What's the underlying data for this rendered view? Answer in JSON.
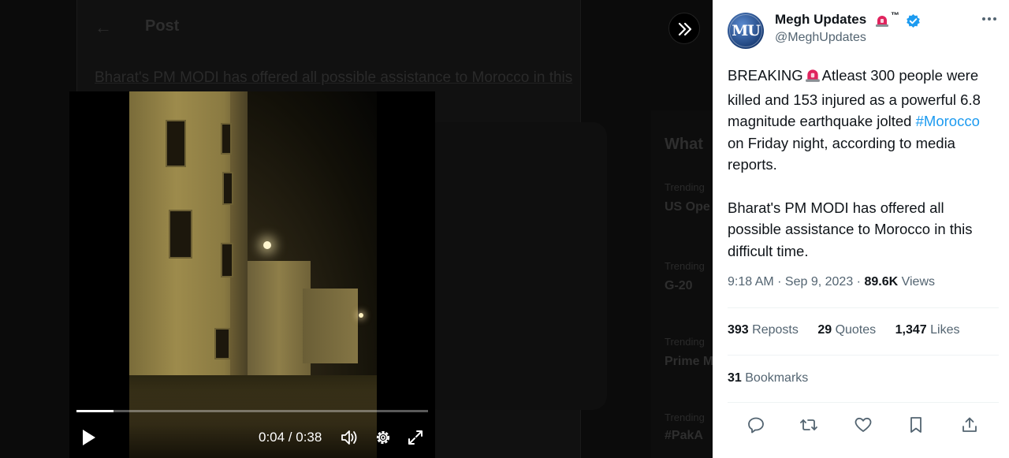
{
  "background": {
    "title": "Post",
    "text": "Bharat's PM MODI has offered all possible assistance to Morocco in this",
    "trends": [
      {
        "label": "What"
      },
      {
        "label": "Trending"
      },
      {
        "label": "US Ope"
      },
      {
        "label": "Trending"
      },
      {
        "label": "G-20"
      },
      {
        "label": "Trending"
      },
      {
        "label": "Prime M"
      },
      {
        "label": "Trending"
      },
      {
        "label": "#PakA"
      }
    ]
  },
  "video": {
    "time": "0:04 / 0:38",
    "progress": 0.106
  },
  "tweet": {
    "author": {
      "name": "Megh Updates",
      "tm": "™",
      "handle": "@MeghUpdates",
      "avatar_text": "MU"
    },
    "body": {
      "breaking": "BREAKING",
      "line1_rest": "Atleast 300 people were killed and 153 injured as a powerful 6.8 magnitude earthquake jolted",
      "hashtag": "#Morocco",
      "line1_end": "on Friday night, according to media reports.",
      "para2": "Bharat's PM MODI has offered all possible assistance to Morocco in this difficult time."
    },
    "meta": {
      "datetime": "9:18 AM · Sep 9, 2023 ·",
      "views_count": "89.6K",
      "views_label": "Views"
    },
    "stats": {
      "reposts_count": "393",
      "reposts_label": "Reposts",
      "quotes_count": "29",
      "quotes_label": "Quotes",
      "likes_count": "1,347",
      "likes_label": "Likes",
      "bookmarks_count": "31",
      "bookmarks_label": "Bookmarks"
    }
  },
  "colors": {
    "accent": "#1d9bf0",
    "siren": "#e0245e",
    "text": "#0f1419",
    "muted": "#536471"
  }
}
